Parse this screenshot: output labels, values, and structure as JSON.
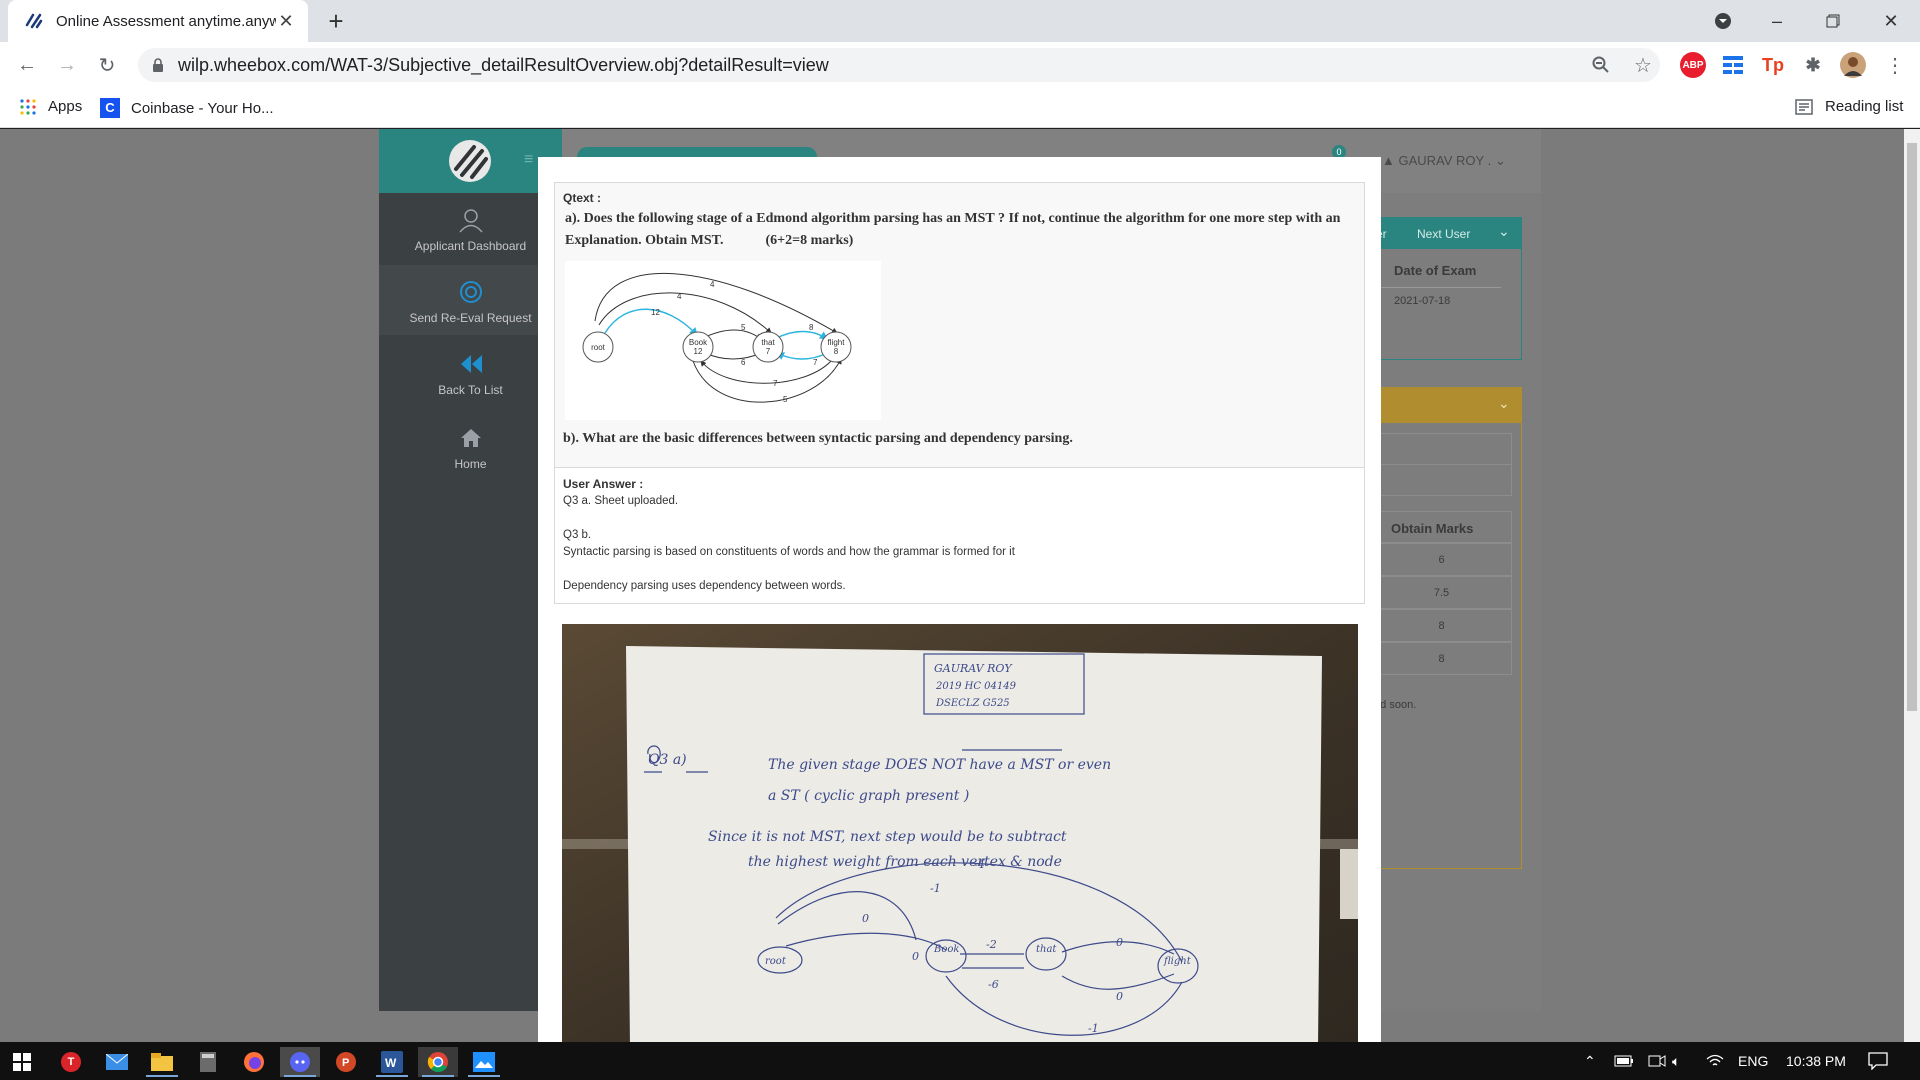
{
  "browser": {
    "tab_title": "Online Assessment anytime.anyw",
    "url": "wilp.wheebox.com/WAT-3/Subjective_detailResultOverview.obj?detailResult=view",
    "bookmarks": [
      "Apps",
      "Coinbase - Your Ho..."
    ],
    "reading_list": "Reading list",
    "ext_abp": "ABP",
    "ext_tp": "Tp"
  },
  "sidebar": {
    "items": [
      {
        "label": "Applicant Dashboard"
      },
      {
        "label": "Send Re-Eval Request"
      },
      {
        "label": "Back To List"
      },
      {
        "label": "Home"
      }
    ]
  },
  "header": {
    "user": "GAURAV ROY .",
    "notification_count": "0",
    "next_user": "Next User",
    "prev_user_partial": "er"
  },
  "exam_panel": {
    "date_label": "Date of Exam",
    "date_value": "2021-07-18",
    "marks_header": "Obtain Marks",
    "marks": [
      "6",
      "7.5",
      "8",
      "8"
    ],
    "note_partial": "ted soon."
  },
  "question": {
    "qtext_label": "Qtext :",
    "part_a": "a). Does the following stage of a Edmond algorithm parsing has an MST ? If not, continue the algorithm for one more step with an Explanation.  Obtain MST.",
    "part_a_marks": "(6+2=8 marks)",
    "part_b": "b). What are the basic differences between syntactic parsing and dependency parsing.",
    "graph": {
      "nodes": [
        {
          "id": "root",
          "label": "root",
          "sub": ""
        },
        {
          "id": "book",
          "label": "Book",
          "sub": "12"
        },
        {
          "id": "that",
          "label": "that",
          "sub": "7"
        },
        {
          "id": "flight",
          "label": "flight",
          "sub": "8"
        }
      ],
      "edge_labels": [
        "4",
        "4",
        "12",
        "5",
        "6",
        "8",
        "7",
        "7",
        "5"
      ]
    }
  },
  "answer": {
    "label": "User Answer :",
    "lines": [
      "Q3 a. Sheet uploaded.",
      "",
      "Q3 b.",
      "Syntactic parsing is based on constituents of words and how the grammar is formed for it",
      "",
      "Dependency parsing uses dependency between words."
    ]
  },
  "sheet": {
    "name_box": [
      "GAURAV  ROY",
      "2019 HC 04149",
      "DSECLZ G525"
    ],
    "q_label": "Q3  a)",
    "line1": "The given stage DOES NOT have a MST or even",
    "line2": "a ST ( cyclic graph present )",
    "line3": "Since it is not MST, next step would be to subtract",
    "line4": "the highest weight from each vertex & node",
    "nodes": [
      "root",
      "Book",
      "that",
      "flight"
    ],
    "weights": [
      "-4",
      "-1",
      "0",
      "-2",
      "-6",
      "0",
      "0",
      "-1",
      "0"
    ]
  },
  "taskbar": {
    "lang": "ENG",
    "time": "10:38 PM"
  },
  "colors": {
    "teal": "#2a8580",
    "sidebar": "#3b4043",
    "gold": "#b08d2e"
  }
}
